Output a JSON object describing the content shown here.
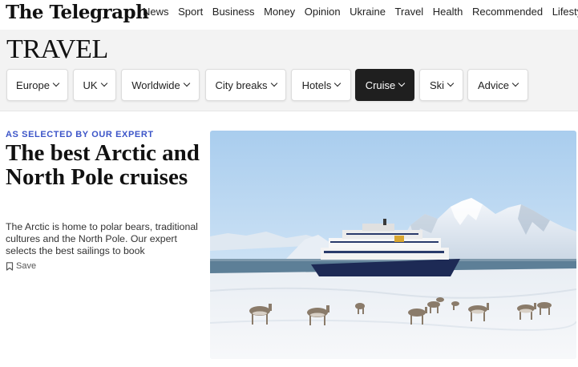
{
  "header": {
    "logo": "The Telegraph",
    "nav": [
      "News",
      "Sport",
      "Business",
      "Money",
      "Opinion",
      "Ukraine",
      "Travel",
      "Health",
      "Recommended",
      "Lifestyle"
    ],
    "active_nav": "Travel"
  },
  "section": {
    "title": "TRAVEL",
    "chips": [
      "Europe",
      "UK",
      "Worldwide",
      "City breaks",
      "Hotels",
      "Cruise",
      "Ski",
      "Advice"
    ],
    "active_chip": "Cruise"
  },
  "article": {
    "kicker": "AS SELECTED BY OUR EXPERT",
    "headline": "The best Arctic and North Pole cruises",
    "standfirst": "The Arctic is home to polar bears, traditional cultures and the North Pole. Our expert selects the best sailings to book",
    "save_label": "Save"
  },
  "colors": {
    "accent_teal": "#2a8f8d",
    "kicker_blue": "#3c55c8",
    "active_chip": "#1f1f1f"
  },
  "icons": {
    "save": "bookmark-icon",
    "chip_dropdown": "chevron-down-icon"
  }
}
